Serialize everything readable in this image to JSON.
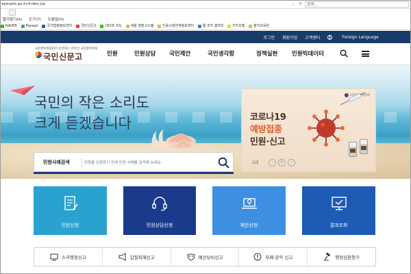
{
  "browser": {
    "url": "epeople.go.kr/index.jsp",
    "nav_controls": "⌄ ↻",
    "search_placeholder": "검색...",
    "menu": [
      "즐겨찾기(A)",
      "도구(T)",
      "도움말(H)"
    ],
    "favorites": [
      "NAVER",
      "Papago",
      "국가법령정보센터",
      "국민신문고",
      "네이버 지도",
      "새올 행정시스템",
      "인용시청천재정보센터",
      "웹 조각 갤러리",
      "카카오맵",
      "홍익교육원"
    ]
  },
  "utility": {
    "login": "로그인",
    "signup": "회원가입",
    "customer_center": "고객센터",
    "language": "Foreign Language"
  },
  "logo": {
    "tagline": "국민권익위원회가 운영하는 온라인 국민참여포털",
    "name": "국민신문고"
  },
  "nav": {
    "items": [
      "민원",
      "민원상담",
      "국민제안",
      "국민생각함",
      "정책실현",
      "민원빅데이터"
    ]
  },
  "hero": {
    "line1": "국민의 작은 소리도",
    "line2": "크게 듣겠습니다"
  },
  "banner": {
    "org": "국민권익위원회",
    "title1": "코로나19",
    "title2": "예방접종",
    "title3": "민원·신고",
    "pager": "1/2",
    "prev": "‹",
    "pause": "II",
    "next": "›"
  },
  "search": {
    "label": "민원사례검색",
    "placeholder": "민원을 신청하기 전에 민원 사례를 검색해 보세요."
  },
  "tiles": [
    {
      "label": "민원신청",
      "color": "#2aa2d0"
    },
    {
      "label": "민원상담신청",
      "color": "#1a3a8c"
    },
    {
      "label": "제안신청",
      "color": "#3d8fe2"
    },
    {
      "label": "결과조회",
      "color": "#1d5bb4"
    }
  ],
  "quick_links": [
    "소극행정신고",
    "갑질피해신고",
    "예산낭비신고",
    "부패·공익 신고",
    "행정심판청구"
  ]
}
